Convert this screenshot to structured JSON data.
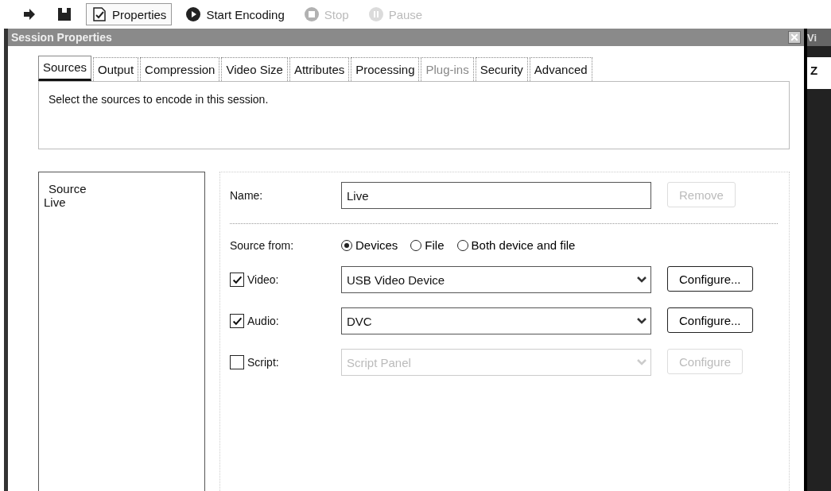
{
  "toolbar": [
    {
      "kind": "arrow",
      "disabled": false,
      "selected": false
    },
    {
      "kind": "save",
      "disabled": false,
      "selected": false
    },
    {
      "kind": "properties",
      "label": "Properties",
      "disabled": false,
      "selected": true
    },
    {
      "kind": "start",
      "label": "Start Encoding",
      "disabled": false,
      "selected": false
    },
    {
      "kind": "stop",
      "label": "Stop",
      "disabled": true,
      "selected": false
    },
    {
      "kind": "pause",
      "label": "Pause",
      "disabled": true,
      "selected": false
    }
  ],
  "dialog": {
    "title": "Session Properties",
    "tabs": [
      {
        "label": "Sources",
        "selected": true,
        "disabled": false
      },
      {
        "label": "Output",
        "selected": false,
        "disabled": false
      },
      {
        "label": "Compression",
        "selected": false,
        "disabled": false
      },
      {
        "label": "Video Size",
        "selected": false,
        "disabled": false
      },
      {
        "label": "Attributes",
        "selected": false,
        "disabled": false
      },
      {
        "label": "Processing",
        "selected": false,
        "disabled": false
      },
      {
        "label": "Plug-ins",
        "selected": false,
        "disabled": true
      },
      {
        "label": "Security",
        "selected": false,
        "disabled": false
      },
      {
        "label": "Advanced",
        "selected": false,
        "disabled": false
      }
    ],
    "description": "Select the sources to encode in this session.",
    "source_list": {
      "header": "Source",
      "items": [
        {
          "label": "Live",
          "selected": false
        }
      ]
    },
    "name_label": "Name:",
    "name_value": "Live",
    "remove_button": {
      "label": "Remove",
      "disabled": true
    },
    "source_from": {
      "label": "Source from:",
      "options": [
        {
          "label": "Devices",
          "selected": true
        },
        {
          "label": "File",
          "selected": false
        },
        {
          "label": "Both device and file",
          "selected": false
        }
      ]
    },
    "inputs": [
      {
        "label": "Video:",
        "checked": true,
        "value": "USB Video Device",
        "disabled": false,
        "configure": "Configure..."
      },
      {
        "label": "Audio:",
        "checked": true,
        "value": "DVC",
        "disabled": false,
        "configure": "Configure..."
      },
      {
        "label": "Script:",
        "checked": false,
        "value": "Script Panel",
        "disabled": true,
        "configure": "Configure"
      }
    ]
  },
  "side_window": {
    "title": "Vi",
    "text": "Z"
  }
}
